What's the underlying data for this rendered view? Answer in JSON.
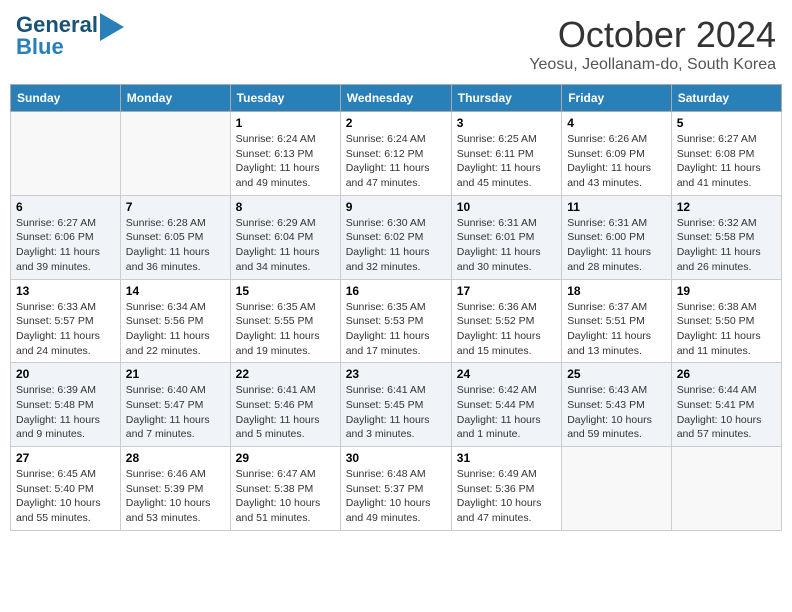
{
  "header": {
    "logo_line1": "General",
    "logo_line2": "Blue",
    "month": "October 2024",
    "location": "Yeosu, Jeollanam-do, South Korea"
  },
  "weekdays": [
    "Sunday",
    "Monday",
    "Tuesday",
    "Wednesday",
    "Thursday",
    "Friday",
    "Saturday"
  ],
  "weeks": [
    [
      {
        "day": "",
        "info": ""
      },
      {
        "day": "",
        "info": ""
      },
      {
        "day": "1",
        "info": "Sunrise: 6:24 AM\nSunset: 6:13 PM\nDaylight: 11 hours and 49 minutes."
      },
      {
        "day": "2",
        "info": "Sunrise: 6:24 AM\nSunset: 6:12 PM\nDaylight: 11 hours and 47 minutes."
      },
      {
        "day": "3",
        "info": "Sunrise: 6:25 AM\nSunset: 6:11 PM\nDaylight: 11 hours and 45 minutes."
      },
      {
        "day": "4",
        "info": "Sunrise: 6:26 AM\nSunset: 6:09 PM\nDaylight: 11 hours and 43 minutes."
      },
      {
        "day": "5",
        "info": "Sunrise: 6:27 AM\nSunset: 6:08 PM\nDaylight: 11 hours and 41 minutes."
      }
    ],
    [
      {
        "day": "6",
        "info": "Sunrise: 6:27 AM\nSunset: 6:06 PM\nDaylight: 11 hours and 39 minutes."
      },
      {
        "day": "7",
        "info": "Sunrise: 6:28 AM\nSunset: 6:05 PM\nDaylight: 11 hours and 36 minutes."
      },
      {
        "day": "8",
        "info": "Sunrise: 6:29 AM\nSunset: 6:04 PM\nDaylight: 11 hours and 34 minutes."
      },
      {
        "day": "9",
        "info": "Sunrise: 6:30 AM\nSunset: 6:02 PM\nDaylight: 11 hours and 32 minutes."
      },
      {
        "day": "10",
        "info": "Sunrise: 6:31 AM\nSunset: 6:01 PM\nDaylight: 11 hours and 30 minutes."
      },
      {
        "day": "11",
        "info": "Sunrise: 6:31 AM\nSunset: 6:00 PM\nDaylight: 11 hours and 28 minutes."
      },
      {
        "day": "12",
        "info": "Sunrise: 6:32 AM\nSunset: 5:58 PM\nDaylight: 11 hours and 26 minutes."
      }
    ],
    [
      {
        "day": "13",
        "info": "Sunrise: 6:33 AM\nSunset: 5:57 PM\nDaylight: 11 hours and 24 minutes."
      },
      {
        "day": "14",
        "info": "Sunrise: 6:34 AM\nSunset: 5:56 PM\nDaylight: 11 hours and 22 minutes."
      },
      {
        "day": "15",
        "info": "Sunrise: 6:35 AM\nSunset: 5:55 PM\nDaylight: 11 hours and 19 minutes."
      },
      {
        "day": "16",
        "info": "Sunrise: 6:35 AM\nSunset: 5:53 PM\nDaylight: 11 hours and 17 minutes."
      },
      {
        "day": "17",
        "info": "Sunrise: 6:36 AM\nSunset: 5:52 PM\nDaylight: 11 hours and 15 minutes."
      },
      {
        "day": "18",
        "info": "Sunrise: 6:37 AM\nSunset: 5:51 PM\nDaylight: 11 hours and 13 minutes."
      },
      {
        "day": "19",
        "info": "Sunrise: 6:38 AM\nSunset: 5:50 PM\nDaylight: 11 hours and 11 minutes."
      }
    ],
    [
      {
        "day": "20",
        "info": "Sunrise: 6:39 AM\nSunset: 5:48 PM\nDaylight: 11 hours and 9 minutes."
      },
      {
        "day": "21",
        "info": "Sunrise: 6:40 AM\nSunset: 5:47 PM\nDaylight: 11 hours and 7 minutes."
      },
      {
        "day": "22",
        "info": "Sunrise: 6:41 AM\nSunset: 5:46 PM\nDaylight: 11 hours and 5 minutes."
      },
      {
        "day": "23",
        "info": "Sunrise: 6:41 AM\nSunset: 5:45 PM\nDaylight: 11 hours and 3 minutes."
      },
      {
        "day": "24",
        "info": "Sunrise: 6:42 AM\nSunset: 5:44 PM\nDaylight: 11 hours and 1 minute."
      },
      {
        "day": "25",
        "info": "Sunrise: 6:43 AM\nSunset: 5:43 PM\nDaylight: 10 hours and 59 minutes."
      },
      {
        "day": "26",
        "info": "Sunrise: 6:44 AM\nSunset: 5:41 PM\nDaylight: 10 hours and 57 minutes."
      }
    ],
    [
      {
        "day": "27",
        "info": "Sunrise: 6:45 AM\nSunset: 5:40 PM\nDaylight: 10 hours and 55 minutes."
      },
      {
        "day": "28",
        "info": "Sunrise: 6:46 AM\nSunset: 5:39 PM\nDaylight: 10 hours and 53 minutes."
      },
      {
        "day": "29",
        "info": "Sunrise: 6:47 AM\nSunset: 5:38 PM\nDaylight: 10 hours and 51 minutes."
      },
      {
        "day": "30",
        "info": "Sunrise: 6:48 AM\nSunset: 5:37 PM\nDaylight: 10 hours and 49 minutes."
      },
      {
        "day": "31",
        "info": "Sunrise: 6:49 AM\nSunset: 5:36 PM\nDaylight: 10 hours and 47 minutes."
      },
      {
        "day": "",
        "info": ""
      },
      {
        "day": "",
        "info": ""
      }
    ]
  ]
}
